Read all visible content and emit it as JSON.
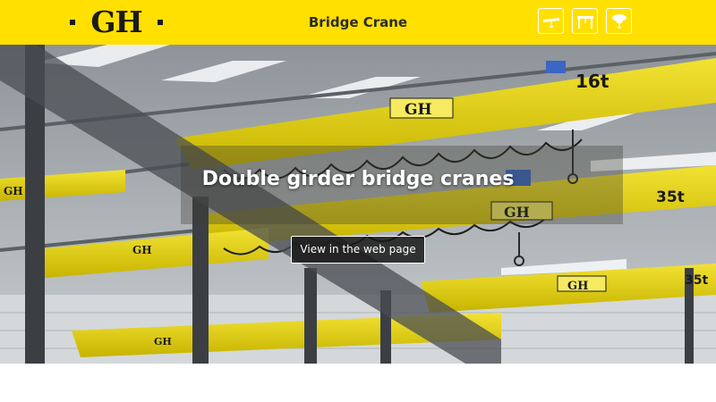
{
  "header": {
    "logo_text": "GH",
    "title": "Bridge Crane",
    "icons": [
      "single-girder-crane-icon",
      "gantry-crane-icon",
      "hoist-icon"
    ]
  },
  "hero": {
    "headline": "Double girder bridge cranes",
    "cta_label": "View in the web page",
    "capacity_labels": [
      "16t",
      "35t",
      "35t"
    ],
    "girder_brand": "GH"
  },
  "colors": {
    "brand_yellow": "#ffe000",
    "text_dark": "#2b2b2b",
    "button_bg": "#191919"
  }
}
